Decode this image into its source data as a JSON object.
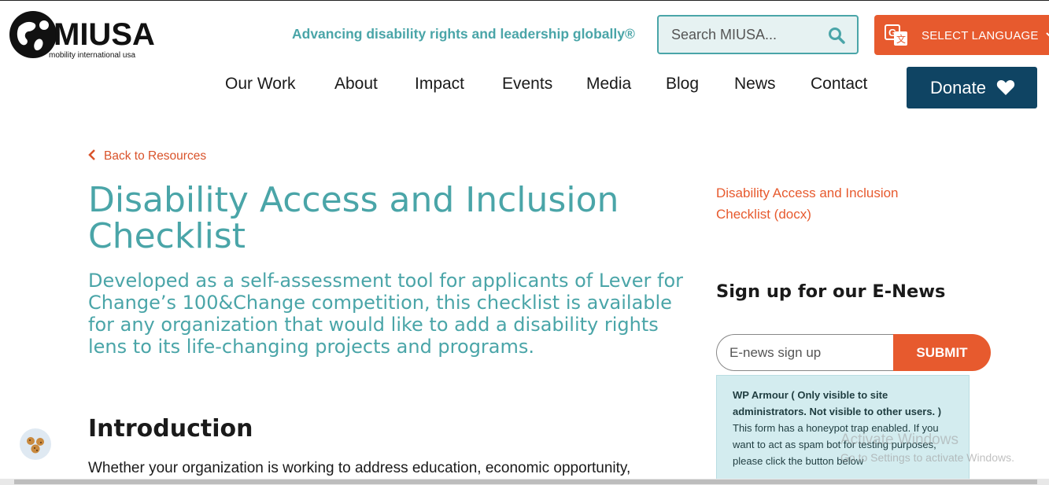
{
  "header": {
    "logo_text": "MIUSA",
    "logo_subtext": "mobility international usa",
    "tagline": "Advancing disability rights and leadership globally®",
    "search_placeholder": "Search MIUSA...",
    "language_label": "SELECT LANGUAGE",
    "donate_label": "Donate"
  },
  "nav": {
    "items": [
      "Our Work",
      "About",
      "Impact",
      "Events",
      "Media",
      "Blog",
      "News",
      "Contact"
    ]
  },
  "main": {
    "back_link": "Back to Resources",
    "title": "Disability Access and Inclusion Checklist",
    "lead": "Developed as a self-assessment tool for applicants of Lever for Change’s 100&Change competition, this checklist is available for any organization that would like to add a disability rights lens to its life-changing projects and programs.",
    "intro_heading": "Introduction",
    "intro_text": "Whether your organization is working to address education, economic opportunity,"
  },
  "sidebar": {
    "download_link": "Disability Access and Inclusion Checklist (docx)",
    "enews_heading": "Sign up for our E-News",
    "enews_placeholder": "E-news sign up",
    "submit_label": "SUBMIT",
    "notice_strong": "WP Armour ( Only visible to site administrators. Not visible to other users. )",
    "notice_text": "This form has a honeypot trap enabled. If you want to act as spam bot for testing purposes, please click the button below"
  },
  "overlay": {
    "watermark_title": "Activate Windows",
    "watermark_sub": "Go to Settings to activate Windows."
  },
  "colors": {
    "teal": "#4aa5a8",
    "orange": "#e75a2e",
    "navy": "#0f4463"
  }
}
